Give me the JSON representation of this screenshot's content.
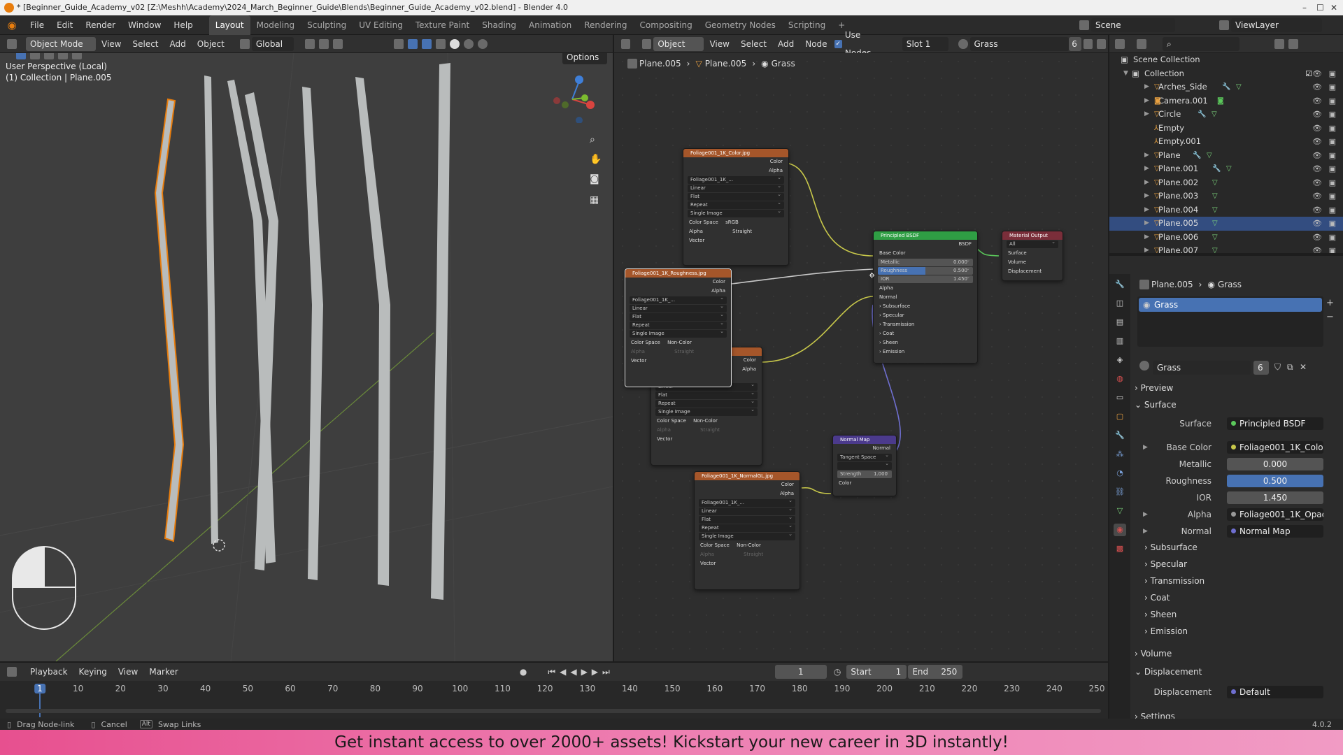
{
  "window": {
    "title": "* [Beginner_Guide_Academy_v02 [Z:\\Meshh\\Academy\\2024_March_Beginner_Guide\\Blends\\Beginner_Guide_Academy_v02.blend] - Blender 4.0",
    "controls": [
      "–",
      "☐",
      "✕"
    ]
  },
  "menu": [
    "File",
    "Edit",
    "Render",
    "Window",
    "Help"
  ],
  "workspaces": [
    "Layout",
    "Modeling",
    "Sculpting",
    "UV Editing",
    "Texture Paint",
    "Shading",
    "Animation",
    "Rendering",
    "Compositing",
    "Geometry Nodes",
    "Scripting",
    "+"
  ],
  "scene": {
    "label": "Scene",
    "viewlayer": "ViewLayer"
  },
  "viewport": {
    "mode": "Object Mode",
    "menus": [
      "View",
      "Select",
      "Add",
      "Object"
    ],
    "transform": "Global",
    "options": "Options",
    "overlay_title": "User Perspective (Local)",
    "overlay_sub": "(1) Collection | Plane.005"
  },
  "node_editor": {
    "type": "Object",
    "menus": [
      "View",
      "Select",
      "Add",
      "Node"
    ],
    "use_nodes": "Use Nodes",
    "slot": "Slot 1",
    "material": "Grass",
    "users": "6",
    "breadcrumb": [
      "Plane.005",
      "Plane.005",
      "Grass"
    ],
    "nodes": {
      "color_tex": {
        "title": "Foliage001_1K_Color.jpg",
        "out1": "Color",
        "out2": "Alpha",
        "image": "Foliage001_1K_...",
        "fields": [
          "Linear",
          "Flat",
          "Repeat",
          "Single Image"
        ],
        "cs_label": "Color Space",
        "cs_value": "sRGB",
        "alpha_label": "Alpha",
        "alpha_value": "Straight",
        "vector": "Vector"
      },
      "rough_tex": {
        "title": "Foliage001_1K_Roughness.jpg",
        "out1": "Color",
        "out2": "Alpha",
        "image": "Foliage001_1K_...",
        "fields": [
          "Linear",
          "Flat",
          "Repeat",
          "Single Image"
        ],
        "cs_label": "Color Space",
        "cs_value": "Non-Color",
        "alpha_label": "Alpha",
        "alpha_value": "Straight",
        "vector": "Vector"
      },
      "opac_tex": {
        "out1": "Color",
        "out2": "Alpha",
        "fields": [
          "Linear",
          "Flat",
          "Repeat",
          "Single Image"
        ],
        "cs_label": "Color Space",
        "cs_value": "Non-Color",
        "alpha_label": "Alpha",
        "alpha_value": "Straight",
        "vector": "Vector"
      },
      "normal_tex": {
        "title": "Foliage001_1K_NormalGL.jpg",
        "out1": "Color",
        "out2": "Alpha",
        "image": "Foliage001_1K_...",
        "fields": [
          "Linear",
          "Flat",
          "Repeat",
          "Single Image"
        ],
        "cs_label": "Color Space",
        "cs_value": "Non-Color",
        "alpha_label": "Alpha",
        "alpha_value": "Straight",
        "vector": "Vector"
      },
      "bsdf": {
        "title": "Principled BSDF",
        "out": "BSDF",
        "base": "Base Color",
        "metallic": "Metallic",
        "metallic_v": "0.000",
        "rough": "Roughness",
        "rough_v": "0.500",
        "ior": "IOR",
        "ior_v": "1.450",
        "alpha": "Alpha",
        "normal": "Normal",
        "subs": [
          "Subsurface",
          "Specular",
          "Transmission",
          "Coat",
          "Sheen",
          "Emission"
        ]
      },
      "output": {
        "title": "Material Output",
        "target": "All",
        "sockets": [
          "Surface",
          "Volume",
          "Displacement"
        ]
      },
      "normal_map": {
        "title": "Normal Map",
        "out": "Normal",
        "space": "Tangent Space",
        "strength": "Strength",
        "strength_v": "1.000",
        "color": "Color"
      }
    }
  },
  "outliner": {
    "root": "Scene Collection",
    "collection": "Collection",
    "items": [
      "Arches_Side",
      "Camera.001",
      "Circle",
      "Empty",
      "Empty.001",
      "Plane",
      "Plane.001",
      "Plane.002",
      "Plane.003",
      "Plane.004",
      "Plane.005",
      "Plane.006",
      "Plane.007"
    ]
  },
  "properties": {
    "breadcrumb": [
      "Plane.005",
      "Grass"
    ],
    "slot": "Grass",
    "material": "Grass",
    "users": "6",
    "sections": {
      "preview": "Preview",
      "surface": "Surface",
      "volume": "Volume",
      "displacement": "Displacement",
      "settings": "Settings"
    },
    "surface_label": "Surface",
    "surface_value": "Principled BSDF",
    "base_label": "Base Color",
    "base_value": "Foliage001_1K_Color.j...",
    "metallic_label": "Metallic",
    "metallic_value": "0.000",
    "rough_label": "Roughness",
    "rough_value": "0.500",
    "ior_label": "IOR",
    "ior_value": "1.450",
    "alpha_label": "Alpha",
    "alpha_value": "Foliage001_1K_Opacit...",
    "normal_label": "Normal",
    "normal_value": "Normal Map",
    "subs": [
      "Subsurface",
      "Specular",
      "Transmission",
      "Coat",
      "Sheen",
      "Emission"
    ],
    "disp_label": "Displacement",
    "disp_value": "Default"
  },
  "timeline": {
    "menus": [
      "Playback",
      "Keying",
      "View",
      "Marker"
    ],
    "current": "1",
    "start_label": "Start",
    "start": "1",
    "end_label": "End",
    "end": "250",
    "ticks": [
      "1",
      "10",
      "20",
      "30",
      "40",
      "50",
      "60",
      "70",
      "80",
      "90",
      "100",
      "110",
      "120",
      "130",
      "140",
      "150",
      "160",
      "170",
      "180",
      "190",
      "200",
      "210",
      "220",
      "230",
      "240",
      "250"
    ]
  },
  "status": {
    "drag": "Drag Node-link",
    "cancel": "Cancel",
    "alt": "Alt",
    "swap": "Swap Links",
    "version": "4.0.2"
  },
  "banner": "Get instant access to over 2000+ assets! Kickstart your new career in 3D instantly!",
  "colors": {
    "accent": "#4772b3",
    "selection": "#e87d0d",
    "texture_node": "#a5562a",
    "shader_node": "#2f9e44",
    "output_node": "#7a2e3a",
    "vector_node": "#4b3a8c"
  }
}
